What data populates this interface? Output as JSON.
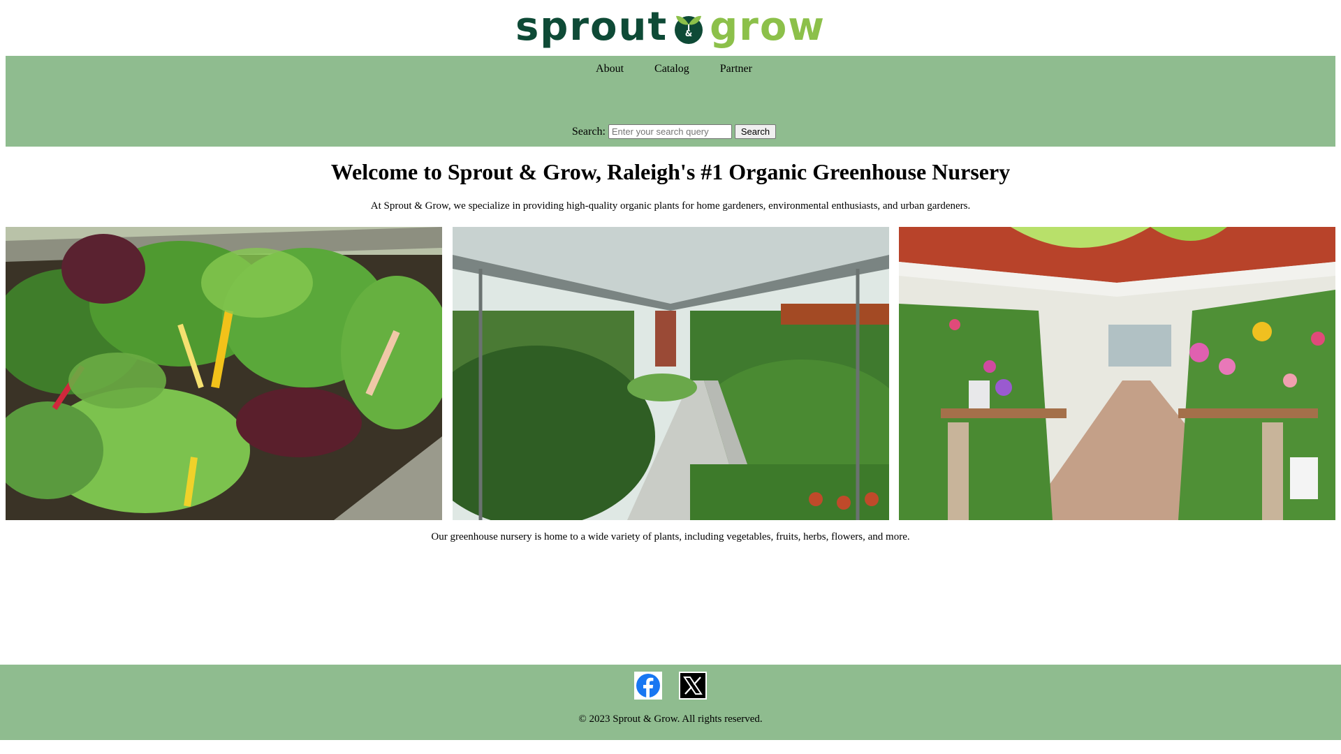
{
  "brand": {
    "logo_word_1": "sprout",
    "logo_word_2": "grow",
    "logo_mark_letter": "&"
  },
  "nav": {
    "items": [
      {
        "label": "About"
      },
      {
        "label": "Catalog"
      },
      {
        "label": "Partner"
      }
    ]
  },
  "search": {
    "label": "Search:",
    "placeholder": "Enter your search query",
    "button_label": "Search"
  },
  "main": {
    "title": "Welcome to Sprout & Grow, Raleigh's #1 Organic Greenhouse Nursery",
    "intro": "At Sprout & Grow, we specialize in providing high-quality organic plants for home gardeners, environmental enthusiasts, and urban gardeners.",
    "variety": "Our greenhouse nursery is home to a wide variety of plants, including vegetables, fruits, herbs, flowers, and more."
  },
  "footer": {
    "social": [
      {
        "icon": "facebook-icon"
      },
      {
        "icon": "x-icon"
      }
    ],
    "copyright": "© 2023 Sprout & Grow. All rights reserved."
  },
  "colors": {
    "band": "#8fbc8f",
    "logo_dark": "#0e4a36",
    "logo_light": "#8cc04a",
    "facebook": "#1877f2"
  }
}
